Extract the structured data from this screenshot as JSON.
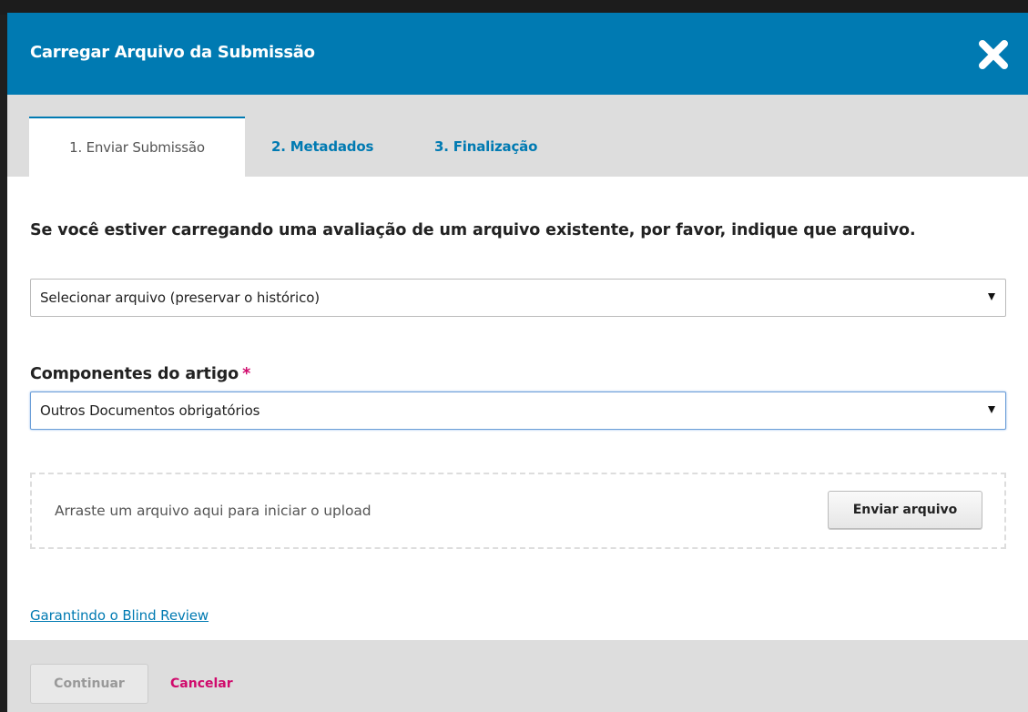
{
  "modal": {
    "title": "Carregar Arquivo da Submissão",
    "close_icon": "close-icon"
  },
  "tabs": [
    {
      "label": "1. Enviar Submissão",
      "active": true
    },
    {
      "label": "2. Metadados",
      "active": false
    },
    {
      "label": "3. Finalização",
      "active": false
    }
  ],
  "form": {
    "revision_label": "Se você estiver carregando uma avaliação de um arquivo existente, por favor, indique que arquivo.",
    "revision_select_value": "Selecionar arquivo (preservar o histórico)",
    "components_label": "Componentes do artigo",
    "required_mark": "*",
    "components_select_value": "Outros Documentos obrigatórios",
    "dropzone_text": "Arraste um arquivo aqui para iniciar o upload",
    "upload_button": "Enviar arquivo",
    "blind_review_link": "Garantindo o Blind Review"
  },
  "footer": {
    "continue_label": "Continuar",
    "cancel_label": "Cancelar"
  },
  "colors": {
    "header": "#007ab2",
    "link": "#007ab2",
    "required": "#d00a6c",
    "cancel": "#d00a6c"
  }
}
